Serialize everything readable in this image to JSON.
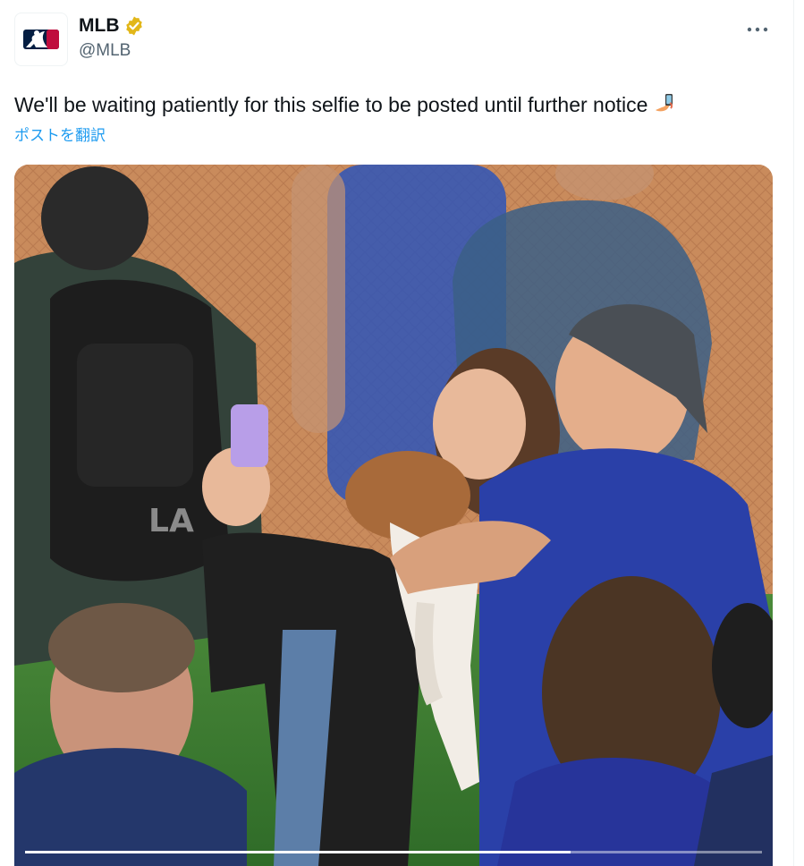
{
  "account": {
    "display_name": "MLB",
    "handle": "@MLB",
    "verified": true,
    "badge_color": "#e2b719"
  },
  "tweet": {
    "text": "We'll be waiting patiently for this selfie to be posted until further notice",
    "emoji": "selfie-emoji",
    "translate_label": "ポストを翻訳"
  },
  "video": {
    "progress_fraction": 0.74
  },
  "colors": {
    "accent": "#1d9bf0",
    "secondary_text": "#536471"
  }
}
